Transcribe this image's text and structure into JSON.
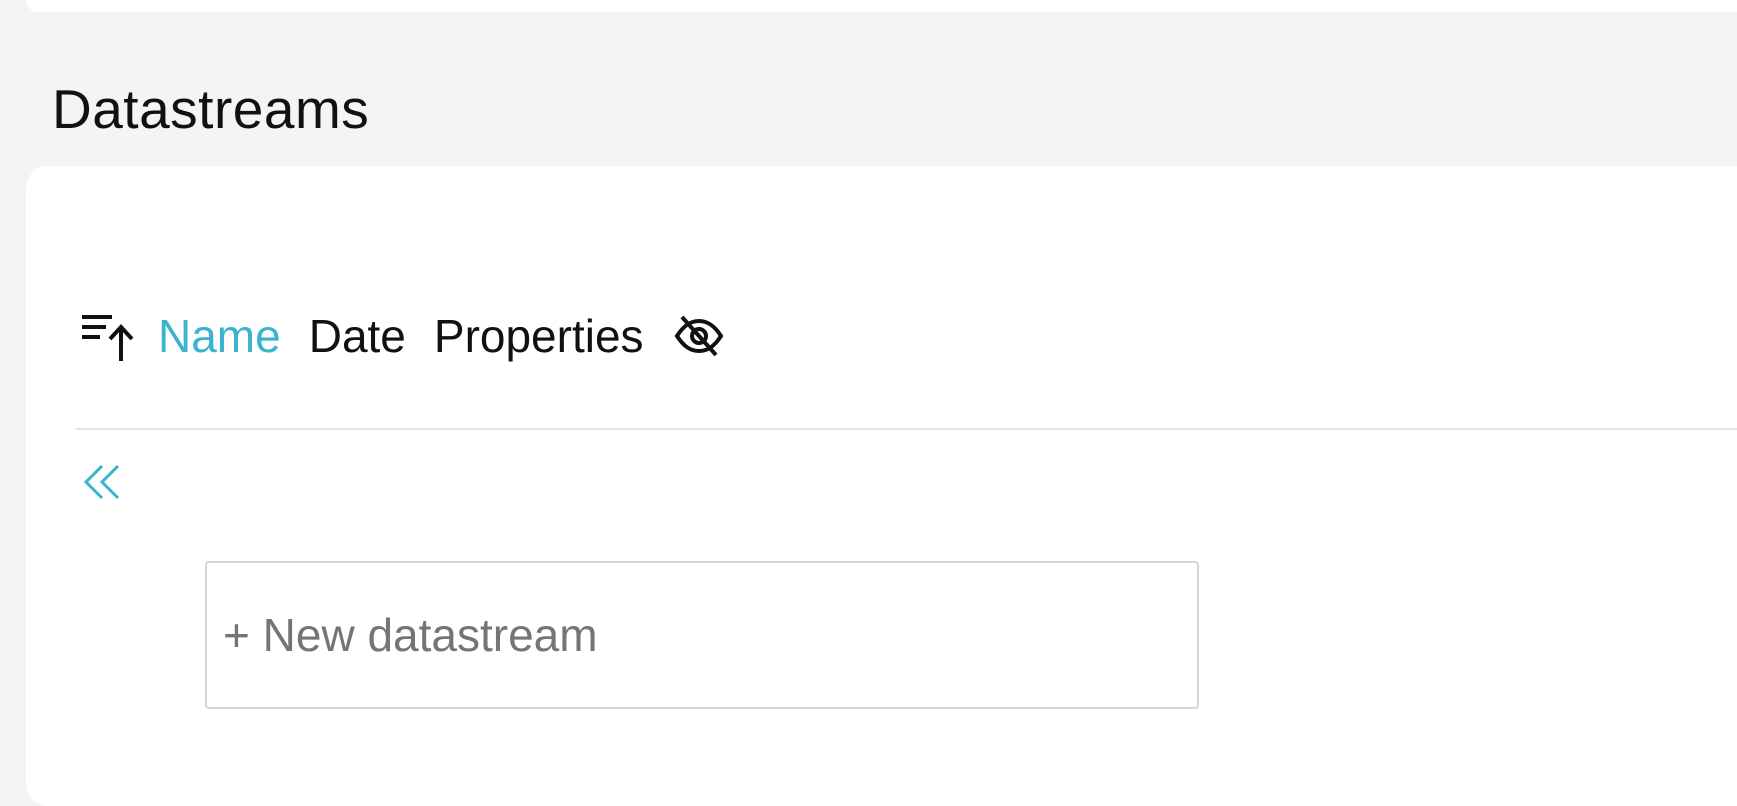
{
  "section": {
    "title": "Datastreams"
  },
  "toolbar": {
    "sort_icon": "sort-ascending-icon",
    "sort_options": [
      {
        "label": "Name",
        "active": true
      },
      {
        "label": "Date",
        "active": false
      },
      {
        "label": "Properties",
        "active": false
      }
    ],
    "hide_icon": "eye-off-icon"
  },
  "list": {
    "collapse_icon": "double-chevron-left-icon",
    "new_item_placeholder": "+ New datastream"
  },
  "colors": {
    "accent": "#3ab3cf",
    "text": "#111111",
    "background": "#f3f4f6",
    "card": "#ffffff"
  }
}
